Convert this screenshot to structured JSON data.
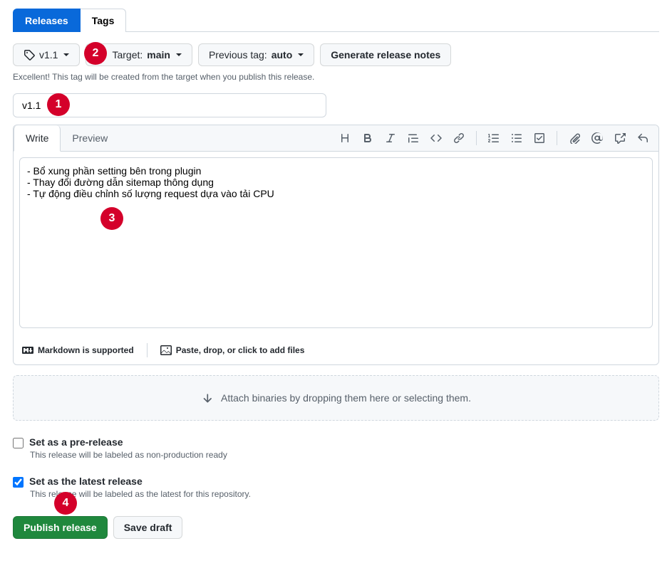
{
  "tabnav": {
    "releases": "Releases",
    "tags": "Tags"
  },
  "controls": {
    "tag_value": "v1.1",
    "target_label": "Target:",
    "target_value": "main",
    "prev_label": "Previous tag:",
    "prev_value": "auto",
    "generate_btn": "Generate release notes"
  },
  "hint": "Excellent! This tag will be created from the target when you publish this release.",
  "title_value": "v1.1",
  "editor": {
    "write_tab": "Write",
    "preview_tab": "Preview",
    "body": "- Bổ xung phần setting bên trong plugin\n- Thay đổi đường dẫn sitemap thông dụng\n- Tự động điều chỉnh số lượng request dựa vào tải CPU",
    "markdown_supported": "Markdown is supported",
    "attach_hint": "Paste, drop, or click to add files"
  },
  "dropzone": "Attach binaries by dropping them here or selecting them.",
  "prerelease": {
    "label": "Set as a pre-release",
    "note": "This release will be labeled as non-production ready"
  },
  "latest": {
    "label": "Set as the latest release",
    "note": "This release will be labeled as the latest for this repository."
  },
  "actions": {
    "publish": "Publish release",
    "draft": "Save draft"
  },
  "badges": {
    "b1": "1",
    "b2": "2",
    "b3": "3",
    "b4": "4"
  }
}
